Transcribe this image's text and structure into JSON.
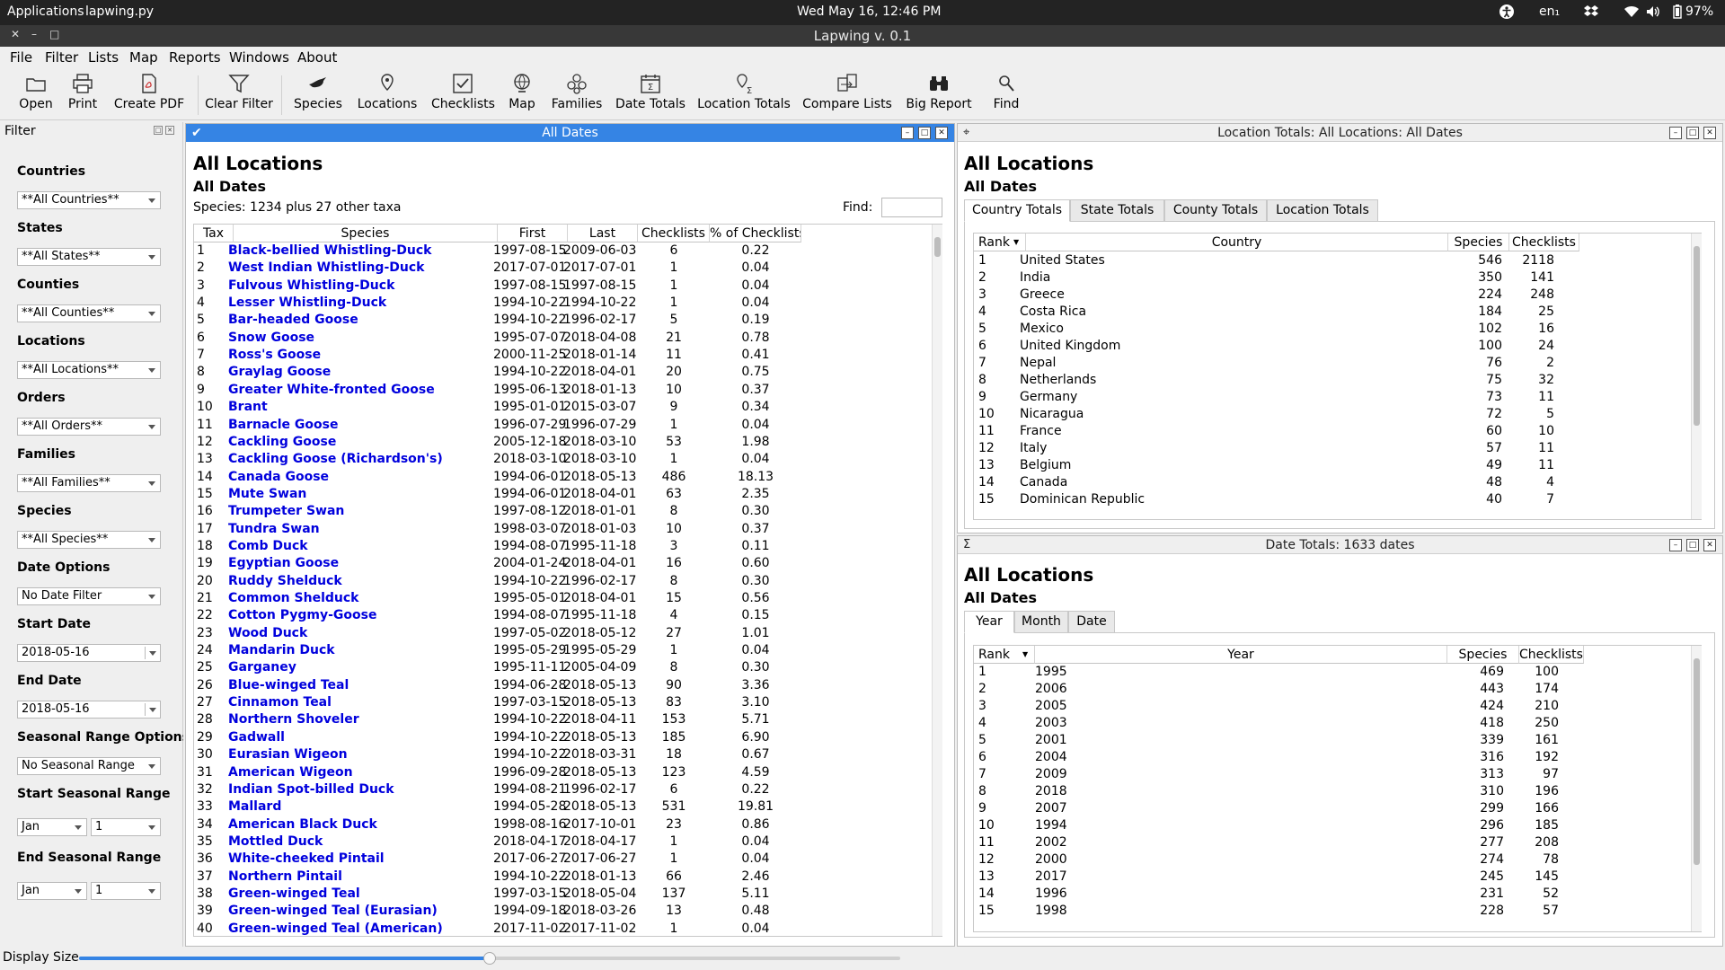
{
  "system": {
    "applications": "Applications",
    "active_window": "lapwing.py",
    "clock": "Wed May 16, 12:46 PM",
    "lang": "en₁",
    "battery": "97%"
  },
  "app": {
    "title": "Lapwing v. 0.1"
  },
  "menu": [
    "File",
    "Filter",
    "Lists",
    "Map",
    "Reports",
    "Windows",
    "About"
  ],
  "toolbar": [
    {
      "label": "Open",
      "icon": "folder-icon"
    },
    {
      "label": "Print",
      "icon": "printer-icon"
    },
    {
      "label": "Create PDF",
      "icon": "pdf-icon"
    },
    {
      "label": "Clear Filter",
      "icon": "filter-icon"
    },
    {
      "label": "Species",
      "icon": "bird-icon"
    },
    {
      "label": "Locations",
      "icon": "location-pin-icon"
    },
    {
      "label": "Checklists",
      "icon": "checklist-icon"
    },
    {
      "label": "Map",
      "icon": "globe-icon"
    },
    {
      "label": "Families",
      "icon": "families-icon"
    },
    {
      "label": "Date Totals",
      "icon": "date-totals-icon"
    },
    {
      "label": "Location Totals",
      "icon": "location-totals-icon"
    },
    {
      "label": "Compare Lists",
      "icon": "compare-icon"
    },
    {
      "label": "Big Report",
      "icon": "binoculars-icon"
    },
    {
      "label": "Find",
      "icon": "search-icon"
    }
  ],
  "filter": {
    "title": "Filter",
    "fields": [
      {
        "label": "Countries",
        "value": "**All Countries**"
      },
      {
        "label": "States",
        "value": "**All States**"
      },
      {
        "label": "Counties",
        "value": "**All Counties**"
      },
      {
        "label": "Locations",
        "value": "**All Locations**"
      },
      {
        "label": "Orders",
        "value": "**All Orders**"
      },
      {
        "label": "Families",
        "value": "**All Families**"
      },
      {
        "label": "Species",
        "value": "**All Species**"
      },
      {
        "label": "Date Options",
        "value": "No Date Filter"
      },
      {
        "label": "Start Date",
        "value": "2018-05-16"
      },
      {
        "label": "End Date",
        "value": "2018-05-16"
      },
      {
        "label": "Seasonal Range Options",
        "value": "No Seasonal Range"
      }
    ],
    "start_seasonal": {
      "label": "Start Seasonal Range",
      "month": "Jan",
      "day": "1"
    },
    "end_seasonal": {
      "label": "End Seasonal Range",
      "month": "Jan",
      "day": "1"
    }
  },
  "species_pane": {
    "title": "All Dates",
    "heading": "All Locations",
    "subheading": "All Dates",
    "summary": "Species: 1234 plus 27 other taxa",
    "find_label": "Find:",
    "columns": [
      "Tax",
      "Species",
      "First",
      "Last",
      "Checklists",
      "% of Checklists"
    ],
    "rows": [
      [
        "1",
        "Black-bellied Whistling-Duck",
        "1997-08-15",
        "2009-06-03",
        "6",
        "0.22"
      ],
      [
        "2",
        "West Indian Whistling-Duck",
        "2017-07-01",
        "2017-07-01",
        "1",
        "0.04"
      ],
      [
        "3",
        "Fulvous Whistling-Duck",
        "1997-08-15",
        "1997-08-15",
        "1",
        "0.04"
      ],
      [
        "4",
        "Lesser Whistling-Duck",
        "1994-10-22",
        "1994-10-22",
        "1",
        "0.04"
      ],
      [
        "5",
        "Bar-headed Goose",
        "1994-10-22",
        "1996-02-17",
        "5",
        "0.19"
      ],
      [
        "6",
        "Snow Goose",
        "1995-07-07",
        "2018-04-08",
        "21",
        "0.78"
      ],
      [
        "7",
        "Ross's Goose",
        "2000-11-25",
        "2018-01-14",
        "11",
        "0.41"
      ],
      [
        "8",
        "Graylag Goose",
        "1994-10-22",
        "2018-04-01",
        "20",
        "0.75"
      ],
      [
        "9",
        "Greater White-fronted Goose",
        "1995-06-13",
        "2018-01-13",
        "10",
        "0.37"
      ],
      [
        "10",
        "Brant",
        "1995-01-01",
        "2015-03-07",
        "9",
        "0.34"
      ],
      [
        "11",
        "Barnacle Goose",
        "1996-07-29",
        "1996-07-29",
        "1",
        "0.04"
      ],
      [
        "12",
        "Cackling Goose",
        "2005-12-18",
        "2018-03-10",
        "53",
        "1.98"
      ],
      [
        "13",
        "Cackling Goose (Richardson's)",
        "2018-03-10",
        "2018-03-10",
        "1",
        "0.04"
      ],
      [
        "14",
        "Canada Goose",
        "1994-06-01",
        "2018-05-13",
        "486",
        "18.13"
      ],
      [
        "15",
        "Mute Swan",
        "1994-06-01",
        "2018-04-01",
        "63",
        "2.35"
      ],
      [
        "16",
        "Trumpeter Swan",
        "1997-08-12",
        "2018-01-01",
        "8",
        "0.30"
      ],
      [
        "17",
        "Tundra Swan",
        "1998-03-07",
        "2018-01-03",
        "10",
        "0.37"
      ],
      [
        "18",
        "Comb Duck",
        "1994-08-07",
        "1995-11-18",
        "3",
        "0.11"
      ],
      [
        "19",
        "Egyptian Goose",
        "2004-01-24",
        "2018-04-01",
        "16",
        "0.60"
      ],
      [
        "20",
        "Ruddy Shelduck",
        "1994-10-22",
        "1996-02-17",
        "8",
        "0.30"
      ],
      [
        "21",
        "Common Shelduck",
        "1995-05-01",
        "2018-04-01",
        "15",
        "0.56"
      ],
      [
        "22",
        "Cotton Pygmy-Goose",
        "1994-08-07",
        "1995-11-18",
        "4",
        "0.15"
      ],
      [
        "23",
        "Wood Duck",
        "1997-05-02",
        "2018-05-12",
        "27",
        "1.01"
      ],
      [
        "24",
        "Mandarin Duck",
        "1995-05-29",
        "1995-05-29",
        "1",
        "0.04"
      ],
      [
        "25",
        "Garganey",
        "1995-11-11",
        "2005-04-09",
        "8",
        "0.30"
      ],
      [
        "26",
        "Blue-winged Teal",
        "1994-06-28",
        "2018-05-13",
        "90",
        "3.36"
      ],
      [
        "27",
        "Cinnamon Teal",
        "1997-03-15",
        "2018-05-13",
        "83",
        "3.10"
      ],
      [
        "28",
        "Northern Shoveler",
        "1994-10-22",
        "2018-04-11",
        "153",
        "5.71"
      ],
      [
        "29",
        "Gadwall",
        "1994-10-22",
        "2018-05-13",
        "185",
        "6.90"
      ],
      [
        "30",
        "Eurasian Wigeon",
        "1994-10-22",
        "2018-03-31",
        "18",
        "0.67"
      ],
      [
        "31",
        "American Wigeon",
        "1996-09-28",
        "2018-05-13",
        "123",
        "4.59"
      ],
      [
        "32",
        "Indian Spot-billed Duck",
        "1994-08-21",
        "1996-02-17",
        "6",
        "0.22"
      ],
      [
        "33",
        "Mallard",
        "1994-05-28",
        "2018-05-13",
        "531",
        "19.81"
      ],
      [
        "34",
        "American Black Duck",
        "1998-08-16",
        "2017-10-01",
        "23",
        "0.86"
      ],
      [
        "35",
        "Mottled Duck",
        "2018-04-17",
        "2018-04-17",
        "1",
        "0.04"
      ],
      [
        "36",
        "White-cheeked Pintail",
        "2017-06-27",
        "2017-06-27",
        "1",
        "0.04"
      ],
      [
        "37",
        "Northern Pintail",
        "1994-10-22",
        "2018-01-13",
        "66",
        "2.46"
      ],
      [
        "38",
        "Green-winged Teal",
        "1997-03-15",
        "2018-05-04",
        "137",
        "5.11"
      ],
      [
        "39",
        "Green-winged Teal (Eurasian)",
        "1994-09-18",
        "2018-03-26",
        "13",
        "0.48"
      ],
      [
        "40",
        "Green-winged Teal (American)",
        "2017-11-02",
        "2017-11-02",
        "1",
        "0.04"
      ]
    ]
  },
  "location_pane": {
    "title": "Location Totals: All Locations: All Dates",
    "heading": "All Locations",
    "subheading": "All Dates",
    "tabs": [
      "Country Totals",
      "State Totals",
      "County Totals",
      "Location Totals"
    ],
    "columns": [
      "Rank",
      "Country",
      "Species",
      "Checklists"
    ],
    "rows": [
      [
        "1",
        "United States",
        "546",
        "2118"
      ],
      [
        "2",
        "India",
        "350",
        "141"
      ],
      [
        "3",
        "Greece",
        "224",
        "248"
      ],
      [
        "4",
        "Costa Rica",
        "184",
        "25"
      ],
      [
        "5",
        "Mexico",
        "102",
        "16"
      ],
      [
        "6",
        "United Kingdom",
        "100",
        "24"
      ],
      [
        "7",
        "Nepal",
        "76",
        "2"
      ],
      [
        "8",
        "Netherlands",
        "75",
        "32"
      ],
      [
        "9",
        "Germany",
        "73",
        "11"
      ],
      [
        "10",
        "Nicaragua",
        "72",
        "5"
      ],
      [
        "11",
        "France",
        "60",
        "10"
      ],
      [
        "12",
        "Italy",
        "57",
        "11"
      ],
      [
        "13",
        "Belgium",
        "49",
        "11"
      ],
      [
        "14",
        "Canada",
        "48",
        "4"
      ],
      [
        "15",
        "Dominican Republic",
        "40",
        "7"
      ]
    ]
  },
  "date_pane": {
    "title": "Date Totals: 1633 dates",
    "heading": "All Locations",
    "subheading": "All Dates",
    "tabs": [
      "Year",
      "Month",
      "Date"
    ],
    "columns": [
      "Rank",
      "Year",
      "Species",
      "Checklists"
    ],
    "rows": [
      [
        "1",
        "1995",
        "469",
        "100"
      ],
      [
        "2",
        "2006",
        "443",
        "174"
      ],
      [
        "3",
        "2005",
        "424",
        "210"
      ],
      [
        "4",
        "2003",
        "418",
        "250"
      ],
      [
        "5",
        "2001",
        "339",
        "161"
      ],
      [
        "6",
        "2004",
        "316",
        "192"
      ],
      [
        "7",
        "2009",
        "313",
        "97"
      ],
      [
        "8",
        "2018",
        "310",
        "196"
      ],
      [
        "9",
        "2007",
        "299",
        "166"
      ],
      [
        "10",
        "1994",
        "296",
        "185"
      ],
      [
        "11",
        "2002",
        "277",
        "208"
      ],
      [
        "12",
        "2000",
        "274",
        "78"
      ],
      [
        "13",
        "2017",
        "245",
        "145"
      ],
      [
        "14",
        "1996",
        "231",
        "52"
      ],
      [
        "15",
        "1998",
        "228",
        "57"
      ]
    ]
  },
  "status": {
    "display_size_label": "Display Size",
    "display_size_value": 0.5
  }
}
